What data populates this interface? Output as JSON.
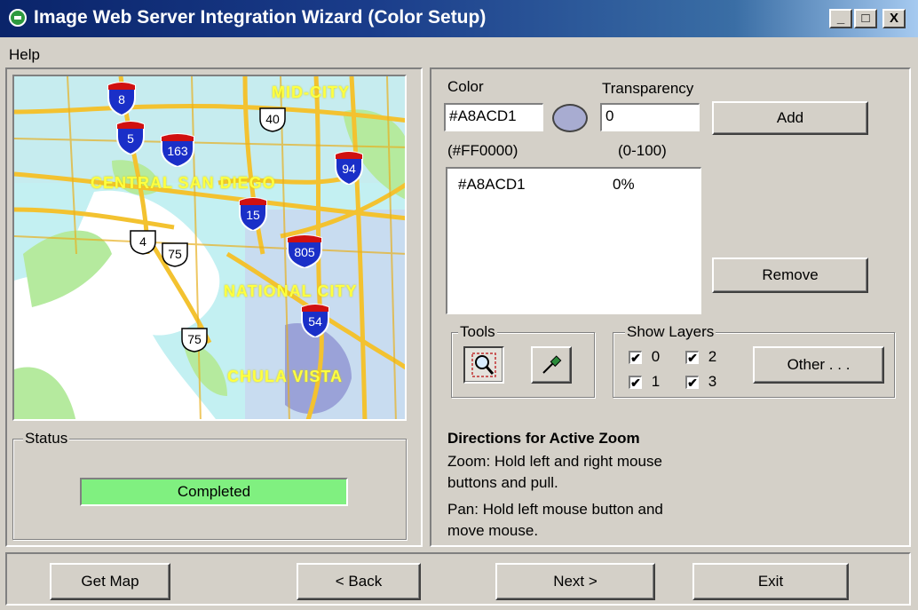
{
  "window": {
    "title": "Image Web Server Integration Wizard (Color Setup)",
    "min": "_",
    "max": "□",
    "close": "X"
  },
  "menu": {
    "help": "Help"
  },
  "map": {
    "labels": [
      "MID-CITY",
      "CENTRAL SAN DIEGO",
      "NATIONAL CITY",
      "CHULA VISTA"
    ],
    "interstates": [
      "8",
      "5",
      "163",
      "94",
      "15",
      "805",
      "54"
    ],
    "highways": [
      "40",
      "4",
      "75",
      "75"
    ]
  },
  "color": {
    "label": "Color",
    "value": "#A8ACD1",
    "swatch": "#A8ACD1",
    "hint": "(#FF0000)",
    "transparency_label": "Transparency",
    "transparency_value": "0",
    "transparency_hint": "(0-100)",
    "add": "Add",
    "remove": "Remove",
    "list": [
      {
        "color": "#A8ACD1",
        "pct": "0%"
      }
    ]
  },
  "tools": {
    "legend": "Tools"
  },
  "layers": {
    "legend": "Show Layers",
    "items": [
      "0",
      "1",
      "2",
      "3"
    ],
    "check": "✔",
    "other": "Other . . ."
  },
  "status": {
    "legend": "Status",
    "text": "Completed",
    "progress": 1.0
  },
  "directions": {
    "title": "Directions for Active Zoom",
    "zoom1": "Zoom:  Hold left and right mouse",
    "zoom2": "buttons and pull.",
    "pan1": "Pan: Hold left mouse button and",
    "pan2": "move mouse."
  },
  "footer": {
    "get_map": "Get Map",
    "back": "< Back",
    "next": "Next >",
    "exit": "Exit"
  }
}
